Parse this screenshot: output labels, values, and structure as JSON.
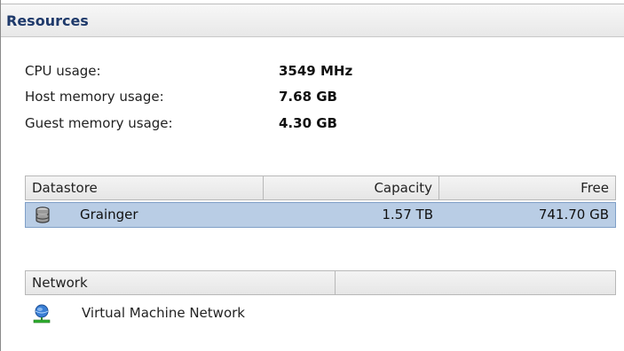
{
  "panel": {
    "title": "Resources"
  },
  "stats": [
    {
      "label": "CPU usage:",
      "value": "3549 MHz"
    },
    {
      "label": "Host memory usage:",
      "value": "7.68 GB"
    },
    {
      "label": "Guest memory usage:",
      "value": "4.30 GB"
    }
  ],
  "datastore_table": {
    "headers": {
      "name": "Datastore",
      "capacity": "Capacity",
      "free": "Free"
    },
    "rows": [
      {
        "icon": "database-icon",
        "name": "Grainger",
        "capacity": "1.57 TB",
        "free": "741.70 GB",
        "selected": true
      }
    ],
    "selected_color": "#b9cde5"
  },
  "network_table": {
    "headers": {
      "name": "Network",
      "extra": ""
    },
    "items": [
      {
        "icon": "network-icon",
        "name": "Virtual Machine Network"
      }
    ]
  },
  "colors": {
    "title_text": "#1f3a6b"
  }
}
